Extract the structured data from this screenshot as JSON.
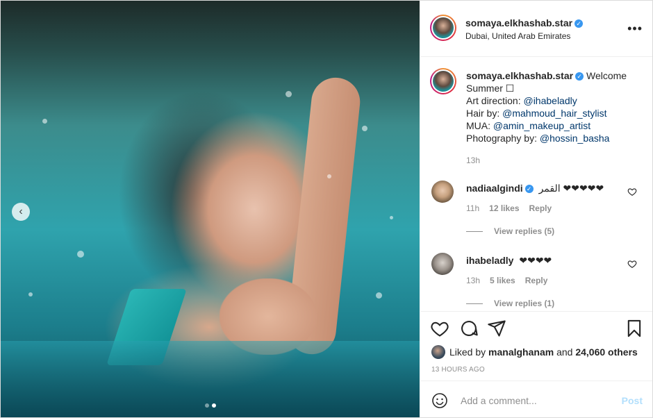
{
  "post": {
    "username": "somaya.elkhashab.star",
    "location": "Dubai, United Arab Emirates",
    "more_label": "•••",
    "nav_prev": "‹",
    "carousel_total": 2,
    "carousel_active": 2
  },
  "caption": {
    "username": "somaya.elkhashab.star",
    "line1": "Welcome Summer ☐",
    "art_label": "Art direction: ",
    "art_mention": "@ihabeladly",
    "hair_label": "Hair by: ",
    "hair_mention": "@mahmoud_hair_stylist",
    "mua_label": "MUA: ",
    "mua_mention": "@amin_makeup_artist",
    "photo_label": "Photography by: ",
    "photo_mention": "@hossin_basha",
    "time": "13h"
  },
  "comments": [
    {
      "username": "nadiaalgindi",
      "text": "القمر ❤❤❤❤❤",
      "time": "11h",
      "likes": "12 likes",
      "reply": "Reply",
      "view_replies": "View replies (5)"
    },
    {
      "username": "ihabeladly",
      "text": "❤❤❤❤",
      "time": "13h",
      "likes": "5 likes",
      "reply": "Reply",
      "view_replies": "View replies (1)"
    }
  ],
  "likes": {
    "prefix": "Liked by ",
    "user": "manalghanam",
    "middle": " and ",
    "others": "24,060 others"
  },
  "ago": "13 HOURS AGO",
  "composer": {
    "placeholder": "Add a comment...",
    "post_label": "Post"
  },
  "colors": {
    "verified": "#3897f0",
    "mention": "#00376b",
    "post_disabled": "#b2dffc"
  }
}
